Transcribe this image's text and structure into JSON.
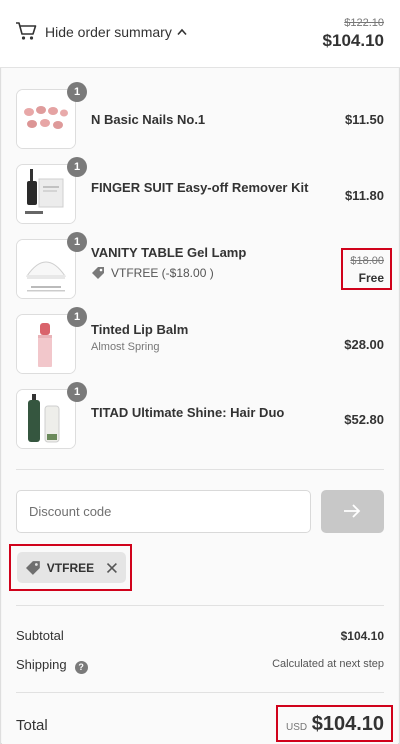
{
  "header": {
    "toggle_label": "Hide order summary",
    "original_total": "$122.10",
    "total": "$104.10"
  },
  "items": [
    {
      "qty": "1",
      "name": "N Basic Nails No.1",
      "price": "$11.50",
      "thumb": "pink-nails-image"
    },
    {
      "qty": "1",
      "name": "FINGER SUIT Easy-off Remover Kit",
      "price": "$11.80",
      "thumb": "remover-kit-image"
    },
    {
      "qty": "1",
      "name": "VANITY TABLE Gel Lamp",
      "discount": "VTFREE (-$18.00 )",
      "original_price": "$18.00",
      "price": "Free",
      "thumb": "gel-lamp-image"
    },
    {
      "qty": "1",
      "name": "Tinted Lip Balm",
      "variant": "Almost Spring",
      "price": "$28.00",
      "thumb": "lip-balm-image"
    },
    {
      "qty": "1",
      "name": "TITAD Ultimate Shine: Hair Duo",
      "price": "$52.80",
      "thumb": "hair-duo-image"
    }
  ],
  "discount": {
    "placeholder": "Discount code",
    "applied_code": "VTFREE"
  },
  "summary": {
    "subtotal_label": "Subtotal",
    "subtotal": "$104.10",
    "shipping_label": "Shipping",
    "shipping_value": "Calculated at next step",
    "help_glyph": "?",
    "total_label": "Total",
    "currency": "USD",
    "total": "$104.10"
  },
  "colors": {
    "highlight": "#d0021b",
    "badge": "#7a7a7a",
    "apply_button": "#c8c8c8"
  }
}
